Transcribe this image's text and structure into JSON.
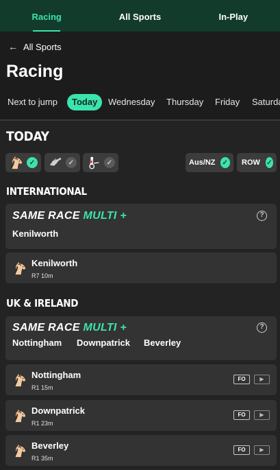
{
  "top_nav": {
    "tabs": [
      {
        "label": "Racing"
      },
      {
        "label": "All Sports"
      },
      {
        "label": "In-Play"
      }
    ]
  },
  "back_link": {
    "label": "All Sports"
  },
  "page_title": "Racing",
  "day_tabs": [
    {
      "label": "Next to jump"
    },
    {
      "label": "Today"
    },
    {
      "label": "Wednesday"
    },
    {
      "label": "Thursday"
    },
    {
      "label": "Friday"
    },
    {
      "label": "Saturday"
    }
  ],
  "today_section": {
    "title": "TODAY"
  },
  "filters": {
    "race_types": [
      {
        "icon": "horse-racing-icon",
        "checked": true
      },
      {
        "icon": "greyhound-icon",
        "checked": false
      },
      {
        "icon": "harness-racing-icon",
        "checked": false
      }
    ],
    "regions": [
      {
        "label": "Aus/NZ",
        "checked": true
      },
      {
        "label": "ROW",
        "checked": true
      }
    ]
  },
  "international": {
    "title": "INTERNATIONAL",
    "srm": {
      "label_a": "SAME RACE",
      "label_b": "MULTI",
      "plus": "+",
      "venues": [
        "Kenilworth"
      ]
    },
    "races": [
      {
        "venue": "Kenilworth",
        "info": "R7 10m"
      }
    ]
  },
  "uk_ireland": {
    "title": "UK & IRELAND",
    "srm": {
      "label_a": "SAME RACE",
      "label_b": "MULTI",
      "plus": "+",
      "venues": [
        "Nottingham",
        "Downpatrick",
        "Beverley"
      ]
    },
    "races": [
      {
        "venue": "Nottingham",
        "info": "R1 15m",
        "badge": "FO"
      },
      {
        "venue": "Downpatrick",
        "info": "R1 23m",
        "badge": "FO"
      },
      {
        "venue": "Beverley",
        "info": "R1 35m",
        "badge": "FO"
      }
    ]
  },
  "colors": {
    "accent": "#3ce3ad",
    "nav_bg": "#123b2c",
    "card_bg": "#333333",
    "page_bg": "#232323"
  }
}
